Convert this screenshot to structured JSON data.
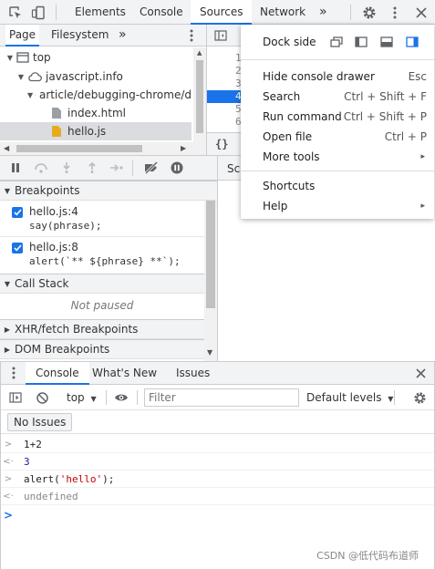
{
  "toolbar": {
    "tabs": [
      "Elements",
      "Console",
      "Sources",
      "Network"
    ],
    "more": "»"
  },
  "navigator": {
    "tabs": [
      "Page",
      "Filesystem"
    ],
    "more": "»",
    "tree": [
      {
        "label": "top"
      },
      {
        "label": "javascript.info"
      },
      {
        "label": "article/debugging-chrome/d"
      },
      {
        "label": "index.html"
      },
      {
        "label": "hello.js"
      }
    ]
  },
  "editor": {
    "line_numbers": [
      "1",
      "2",
      "3",
      "4",
      "5",
      "6"
    ],
    "pretty_print": "{}",
    "scope_tab": "Sc"
  },
  "debugger": {
    "breakpoints_title": "Breakpoints",
    "breakpoints": [
      {
        "location": "hello.js:4",
        "code": "say(phrase);"
      },
      {
        "location": "hello.js:8",
        "code": "alert(`** ${phrase} **`);"
      }
    ],
    "call_stack_title": "Call Stack",
    "call_stack_status": "Not paused",
    "xhr_title": "XHR/fetch Breakpoints",
    "dom_title": "DOM Breakpoints"
  },
  "menu": {
    "dock_side_label": "Dock side",
    "items": [
      {
        "label": "Hide console drawer",
        "shortcut": "Esc"
      },
      {
        "label": "Search",
        "shortcut": "Ctrl + Shift + F"
      },
      {
        "label": "Run command",
        "shortcut": "Ctrl + Shift + P"
      },
      {
        "label": "Open file",
        "shortcut": "Ctrl + P"
      },
      {
        "label": "More tools",
        "shortcut": "▸"
      }
    ],
    "items2": [
      {
        "label": "Shortcuts",
        "shortcut": ""
      },
      {
        "label": "Help",
        "shortcut": "▸"
      }
    ]
  },
  "drawer": {
    "tabs": [
      "Console",
      "What's New",
      "Issues"
    ]
  },
  "console": {
    "context": "top",
    "filter_placeholder": "Filter",
    "levels": "Default levels",
    "issues_button": "No Issues",
    "lines": [
      {
        "prefix": ">",
        "text": "1+2",
        "kind": "input"
      },
      {
        "prefix": "<·",
        "text": "3",
        "kind": "result-number"
      },
      {
        "prefix": ">",
        "text_pre": "alert(",
        "text_str": "'hello'",
        "text_post": ");",
        "kind": "input"
      },
      {
        "prefix": "<·",
        "text": "undefined",
        "kind": "result-undefined"
      }
    ],
    "prompt": ">"
  },
  "watermark": "CSDN @低代码布道师",
  "colors": {
    "accent": "#1a73e8",
    "string": "#c80000",
    "number": "#1a1aa6"
  }
}
